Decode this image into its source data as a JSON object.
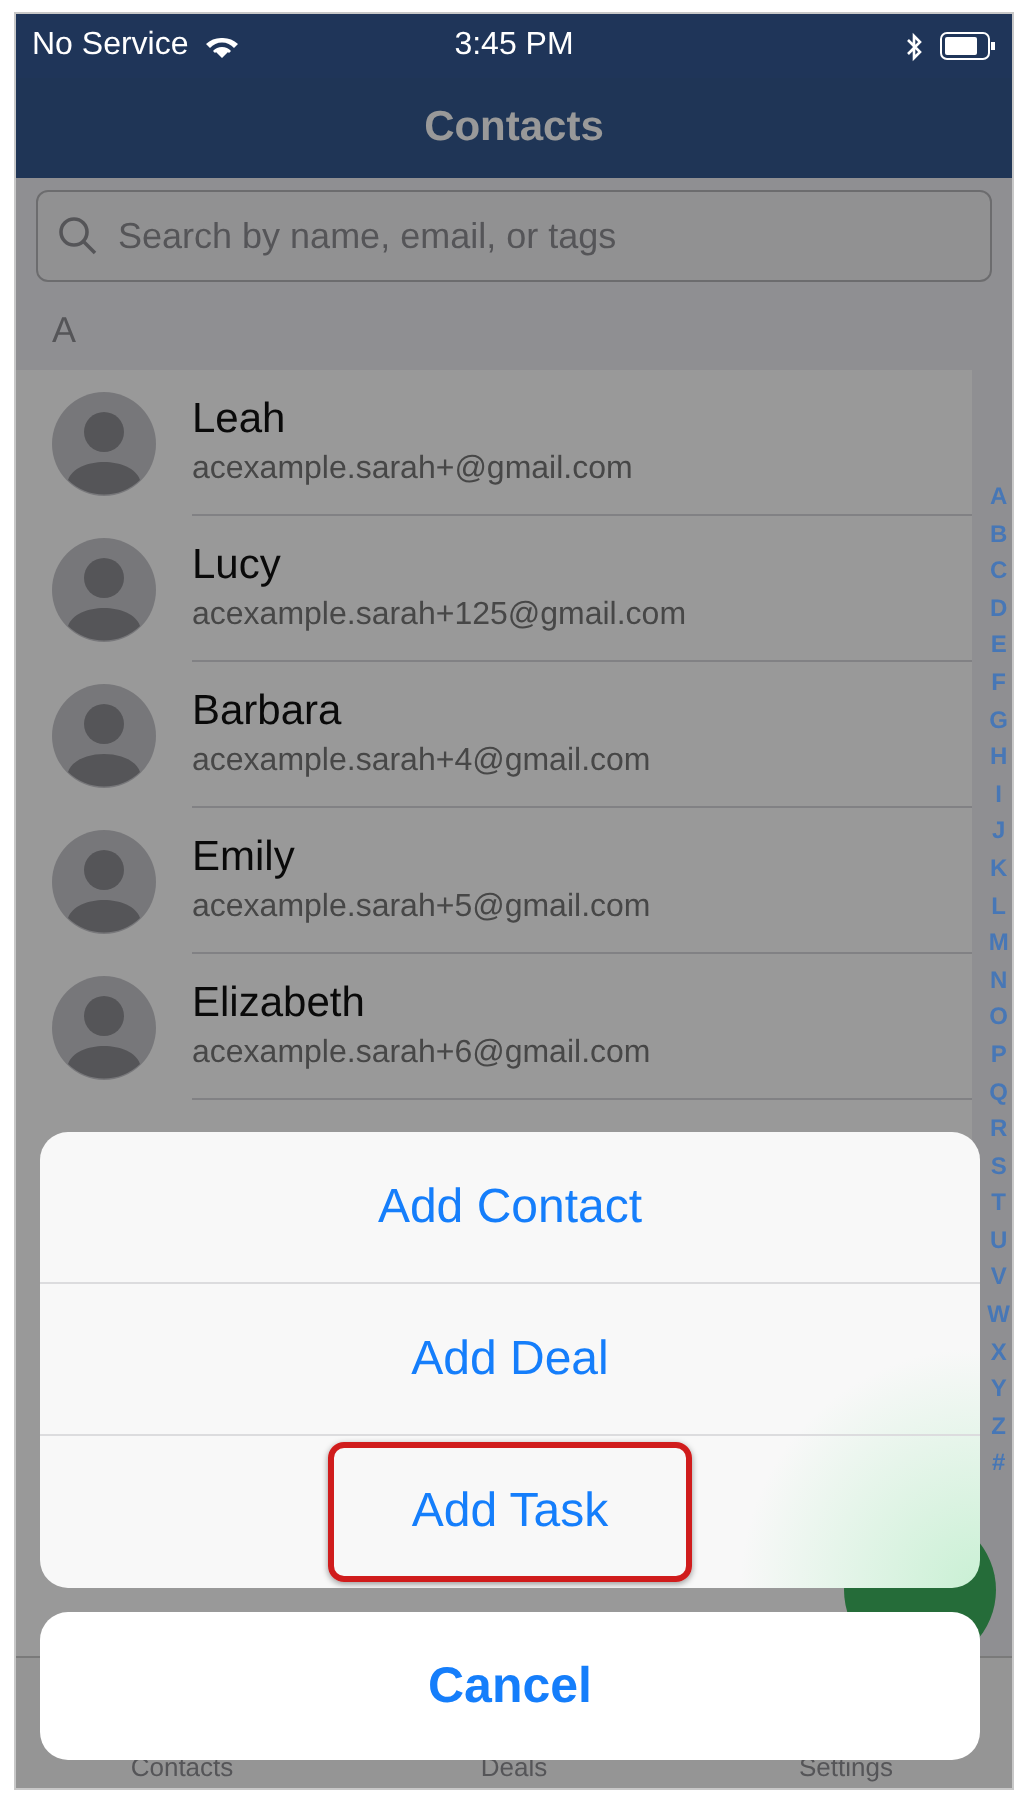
{
  "status_bar": {
    "carrier": "No Service",
    "time": "3:45 PM"
  },
  "nav": {
    "title": "Contacts"
  },
  "search": {
    "placeholder": "Search by name, email, or tags"
  },
  "section": "A",
  "contacts": [
    {
      "name": "Leah",
      "email": "acexample.sarah+@gmail.com"
    },
    {
      "name": "Lucy",
      "email": "acexample.sarah+125@gmail.com"
    },
    {
      "name": "Barbara",
      "email": "acexample.sarah+4@gmail.com"
    },
    {
      "name": "Emily",
      "email": "acexample.sarah+5@gmail.com"
    },
    {
      "name": "Elizabeth",
      "email": "acexample.sarah+6@gmail.com"
    }
  ],
  "index_letters": [
    "A",
    "B",
    "C",
    "D",
    "E",
    "F",
    "G",
    "H",
    "I",
    "J",
    "K",
    "L",
    "M",
    "N",
    "O",
    "P",
    "Q",
    "R",
    "S",
    "T",
    "U",
    "V",
    "W",
    "X",
    "Y",
    "Z",
    "#"
  ],
  "tabs": [
    {
      "label": "Contacts"
    },
    {
      "label": "Deals"
    },
    {
      "label": "Settings"
    }
  ],
  "action_sheet": {
    "actions": [
      {
        "label": "Add Contact",
        "highlighted": false
      },
      {
        "label": "Add Deal",
        "highlighted": false
      },
      {
        "label": "Add Task",
        "highlighted": true
      }
    ],
    "cancel": "Cancel"
  }
}
